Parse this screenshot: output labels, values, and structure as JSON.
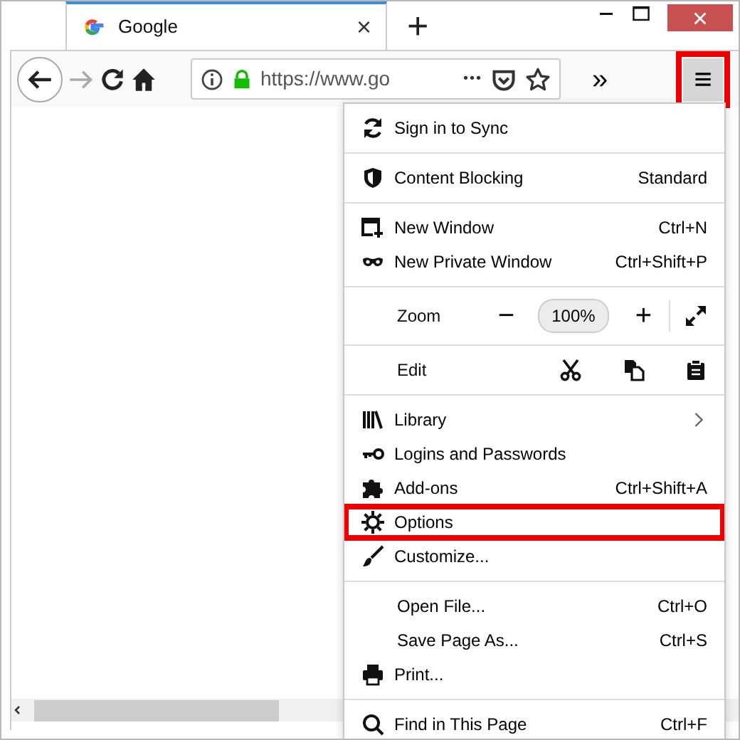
{
  "tab": {
    "title": "Google",
    "close": "×",
    "selected": true
  },
  "new_tab": "+",
  "toolbar": {
    "url": "https://www.go",
    "page_actions": "•••",
    "overflow": "»",
    "menu_button": {
      "label": "≡",
      "annotated": true
    }
  },
  "menu": {
    "sections": [
      {
        "items": [
          {
            "kind": "item",
            "label": "Sign in to Sync",
            "annotated": false
          }
        ]
      },
      {
        "items": [
          {
            "kind": "item",
            "label": "Content Blocking",
            "shortcut": "Standard",
            "annotated": false
          }
        ]
      },
      {
        "items": [
          {
            "kind": "item",
            "label": "New Window",
            "shortcut": "Ctrl+N",
            "annotated": false
          },
          {
            "kind": "item",
            "label": "New Private Window",
            "shortcut": "Ctrl+Shift+P",
            "annotated": false
          }
        ]
      },
      {
        "items": [
          {
            "kind": "zoom",
            "label": "Zoom",
            "minus": "−",
            "value": "100%",
            "plus": "+"
          }
        ]
      },
      {
        "items": [
          {
            "kind": "edit",
            "label": "Edit"
          }
        ]
      },
      {
        "items": [
          {
            "kind": "item",
            "label": "Library",
            "submenu": true,
            "annotated": false
          },
          {
            "kind": "item",
            "label": "Logins and Passwords",
            "annotated": false
          },
          {
            "kind": "item",
            "label": "Add-ons",
            "shortcut": "Ctrl+Shift+A",
            "annotated": false
          },
          {
            "kind": "item",
            "label": "Options",
            "annotated": true
          },
          {
            "kind": "item",
            "label": "Customize...",
            "annotated": false
          }
        ]
      },
      {
        "items": [
          {
            "kind": "item",
            "label": "Open File...",
            "shortcut": "Ctrl+O",
            "annotated": false
          },
          {
            "kind": "item",
            "label": "Save Page As...",
            "shortcut": "Ctrl+S",
            "annotated": false
          },
          {
            "kind": "item",
            "label": "Print...",
            "annotated": false
          }
        ]
      },
      {
        "items": [
          {
            "kind": "item",
            "label": "Find in This Page",
            "shortcut": "Ctrl+F",
            "annotated": false
          }
        ]
      }
    ]
  }
}
